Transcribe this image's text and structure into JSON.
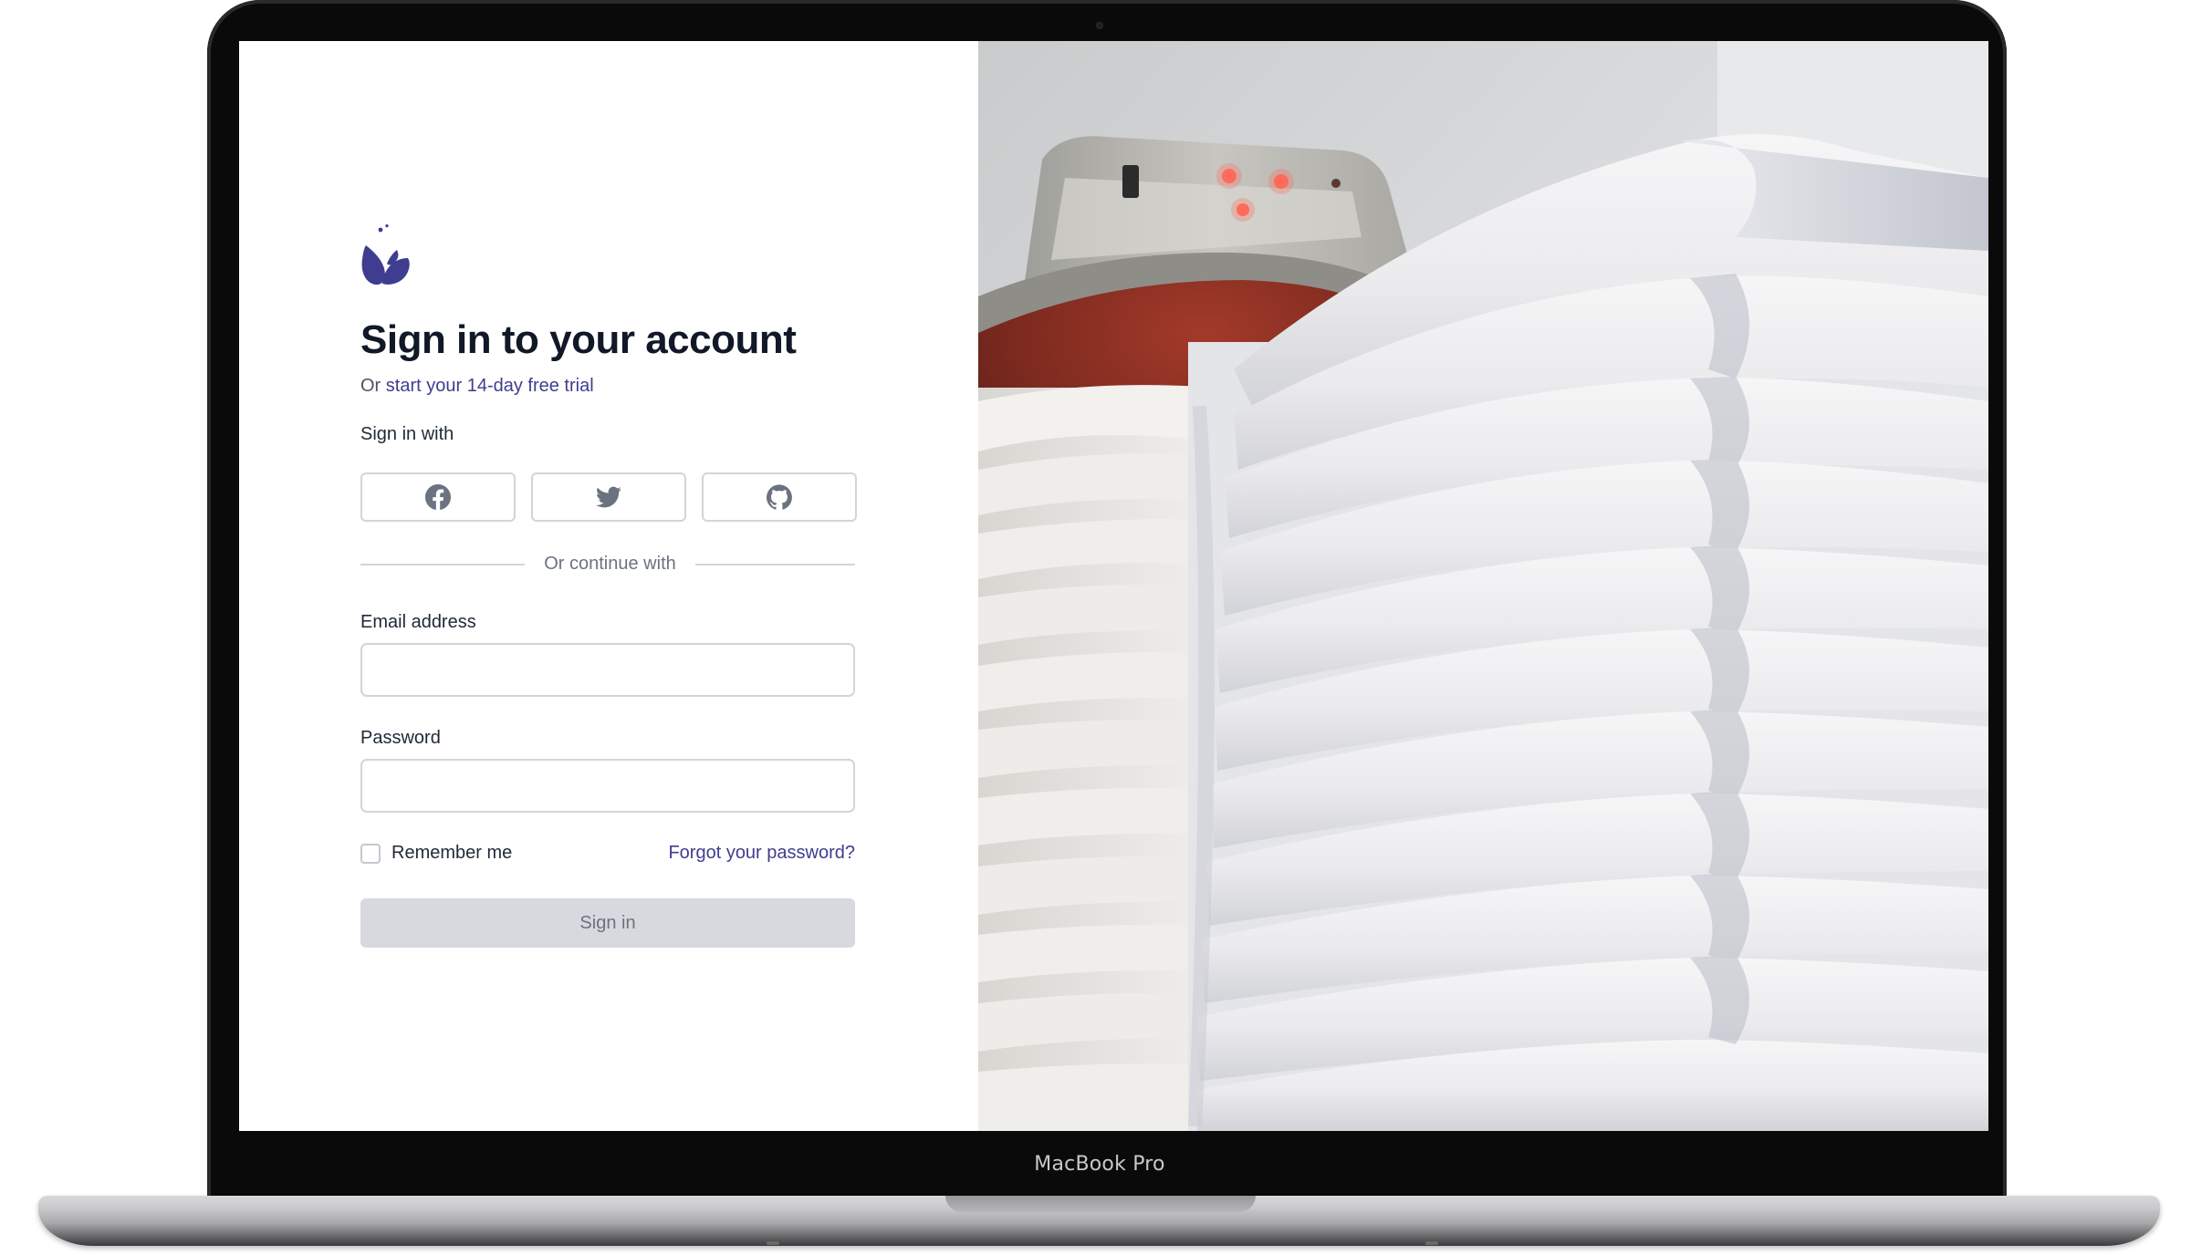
{
  "device": {
    "label": "MacBook Pro"
  },
  "auth": {
    "title": "Sign in to your account",
    "subtitle_prefix": "Or",
    "trial_link": "start your 14-day free trial",
    "social_label": "Sign in with",
    "social_providers": [
      "facebook-icon",
      "twitter-icon",
      "github-icon"
    ],
    "divider": "Or continue with",
    "email_label": "Email address",
    "email_value": "",
    "password_label": "Password",
    "password_value": "",
    "remember_label": "Remember me",
    "remember_checked": false,
    "forgot_link": "Forgot your password?",
    "submit_label": "Sign in"
  },
  "colors": {
    "brand": "#3f3d8f",
    "heading": "#111827",
    "button_disabled_bg": "#d8d9de"
  },
  "hero_image": {
    "subject": "stack of folded white towels in front of a laundry machine"
  }
}
